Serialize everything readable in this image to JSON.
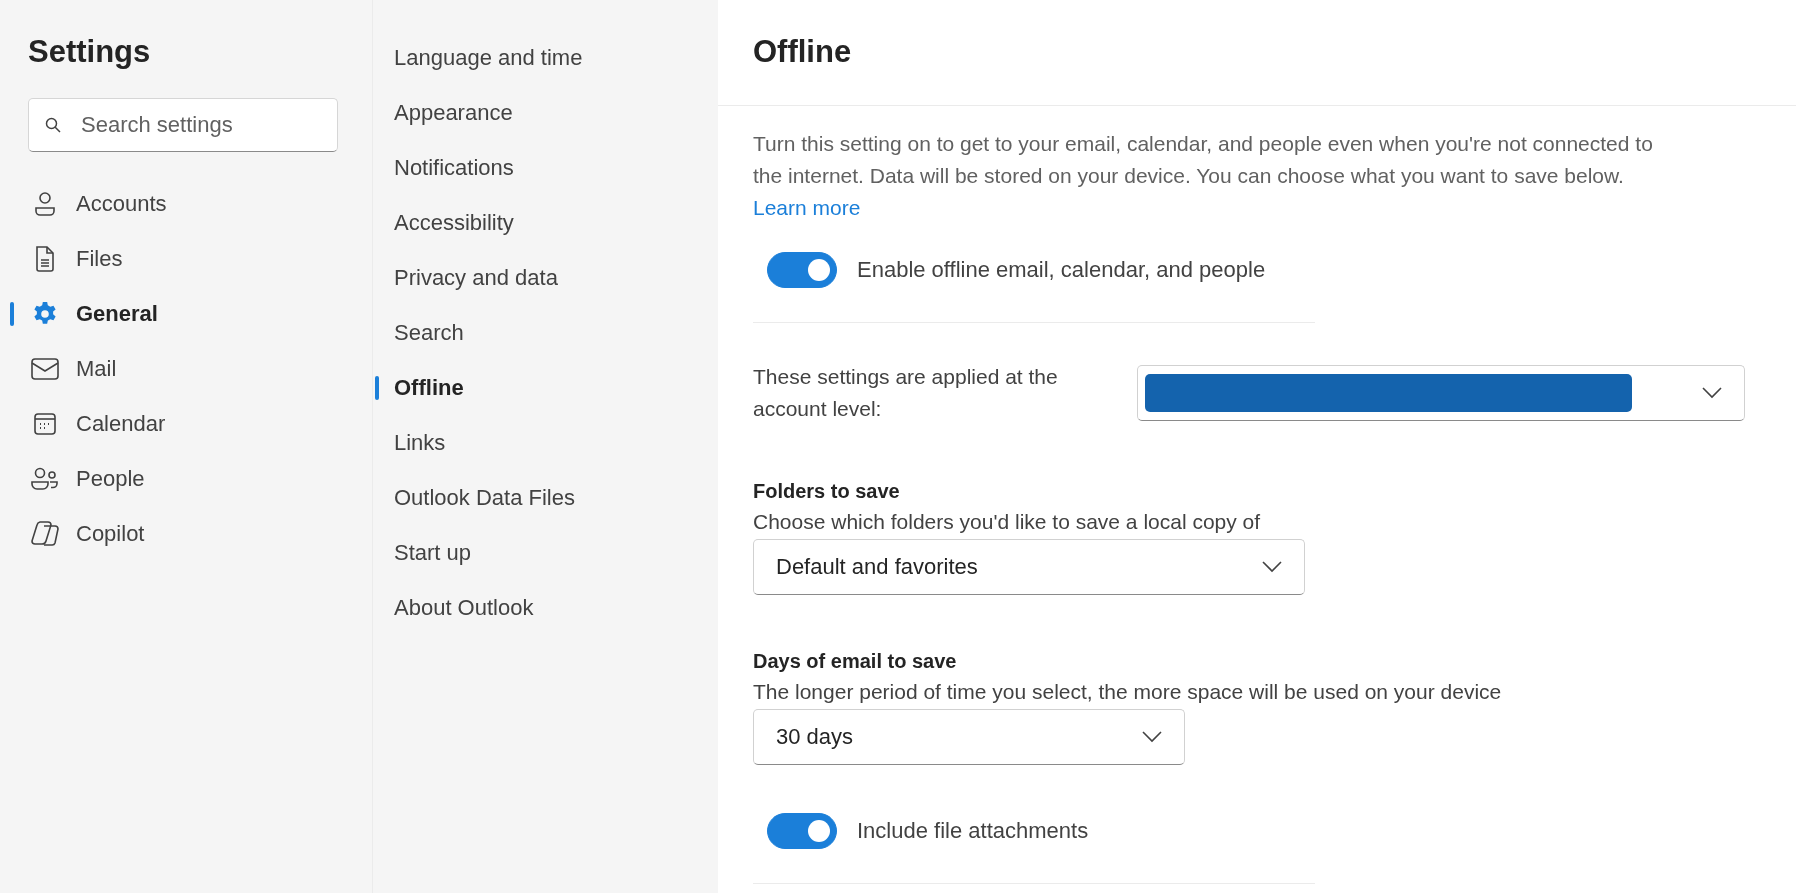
{
  "sidebar": {
    "title": "Settings",
    "search": {
      "placeholder": "Search settings"
    },
    "items": [
      {
        "label": "Accounts",
        "selected": false
      },
      {
        "label": "Files",
        "selected": false
      },
      {
        "label": "General",
        "selected": true
      },
      {
        "label": "Mail",
        "selected": false
      },
      {
        "label": "Calendar",
        "selected": false
      },
      {
        "label": "People",
        "selected": false
      },
      {
        "label": "Copilot",
        "selected": false
      }
    ]
  },
  "categories": {
    "items": [
      {
        "label": "Language and time",
        "selected": false
      },
      {
        "label": "Appearance",
        "selected": false
      },
      {
        "label": "Notifications",
        "selected": false
      },
      {
        "label": "Accessibility",
        "selected": false
      },
      {
        "label": "Privacy and data",
        "selected": false
      },
      {
        "label": "Search",
        "selected": false
      },
      {
        "label": "Offline",
        "selected": true
      },
      {
        "label": "Links",
        "selected": false
      },
      {
        "label": "Outlook Data Files",
        "selected": false
      },
      {
        "label": "Start up",
        "selected": false
      },
      {
        "label": "About Outlook",
        "selected": false
      }
    ]
  },
  "panel": {
    "title": "Offline",
    "intro": {
      "text": "Turn this setting on to get to your email, calendar, and people even when you're not connected to the internet. Data will be stored on your device. You can choose what you want to save below.",
      "link": "Learn more"
    },
    "settings": [
      {
        "kind": "toggle",
        "label": "Enable offline email, calendar, and people",
        "on": true
      },
      {
        "kind": "account",
        "label": "These settings are applied at the account level:"
      },
      {
        "kind": "select",
        "heading": "Folders to save",
        "hint": "Choose which folders you'd like to save a local copy of",
        "value": "Default and favorites"
      },
      {
        "kind": "select",
        "heading": "Days of email to save",
        "hint": "The longer period of time you select, the more space will be used on your device",
        "value": "30 days"
      },
      {
        "kind": "toggle",
        "label": "Include file attachments",
        "on": true
      }
    ]
  }
}
